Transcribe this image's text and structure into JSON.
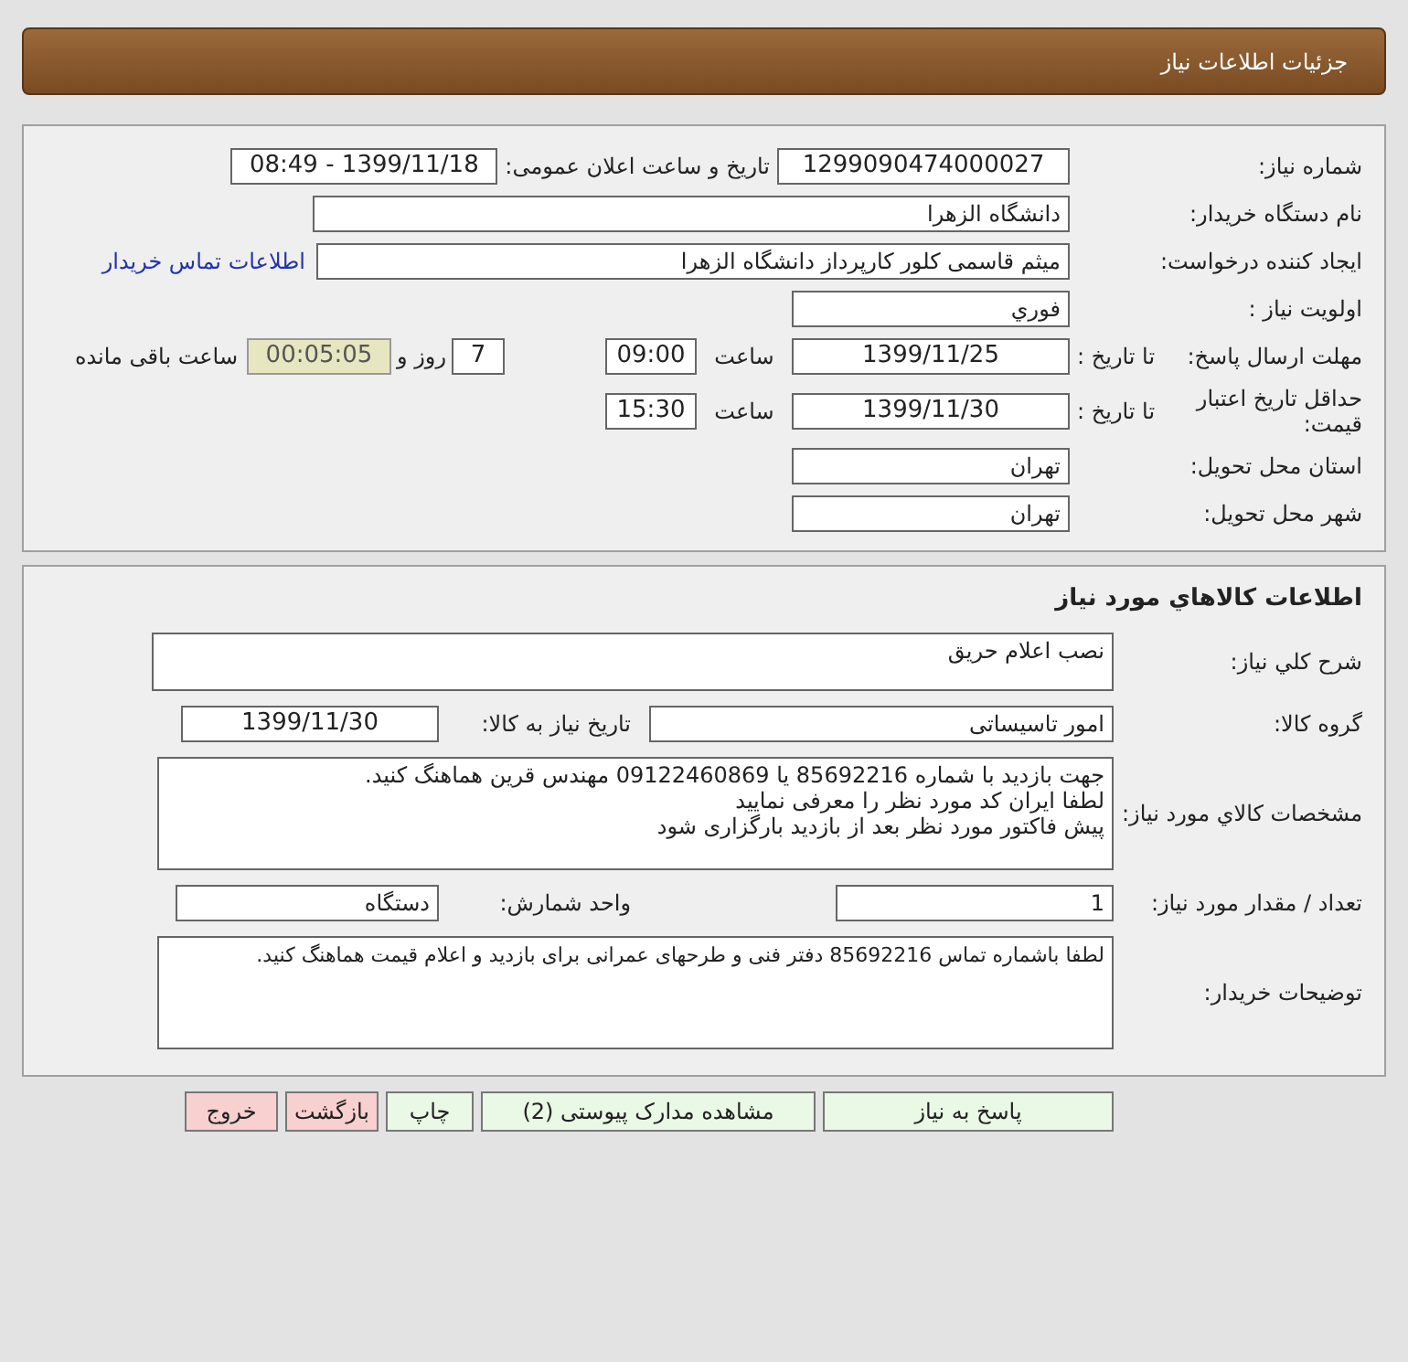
{
  "header": {
    "title": "جزئیات اطلاعات نیاز"
  },
  "need_details": {
    "need_number": {
      "label": "شماره نیاز:",
      "value": "1299090474000027"
    },
    "announce": {
      "label": "تاریخ و ساعت اعلان عمومی:",
      "value": "1399/11/18 - 08:49"
    },
    "buyer": {
      "label": "نام دستگاه خریدار:",
      "value": "دانشگاه الزهرا"
    },
    "creator": {
      "label": "ایجاد کننده درخواست:",
      "value": "میثم  قاسمی کلور کارپرداز دانشگاه الزهرا",
      "link": "اطلاعات تماس خریدار"
    },
    "priority": {
      "label": "اولویت نیاز :",
      "value": "فوري"
    },
    "deadline": {
      "label": "مهلت ارسال پاسخ:",
      "sublabel": "تا تاریخ :",
      "date": "1399/11/25",
      "time_label": "ساعت",
      "time": "09:00",
      "days": "7",
      "days_label": "روز و",
      "remaining": "00:05:05",
      "remaining_label": "ساعت باقی مانده"
    },
    "validity": {
      "label": "حداقل تاریخ اعتبار قیمت:",
      "sublabel": "تا تاریخ :",
      "date": "1399/11/30",
      "time_label": "ساعت",
      "time": "15:30"
    },
    "province": {
      "label": "استان محل تحویل:",
      "value": "تهران"
    },
    "city": {
      "label": "شهر محل تحویل:",
      "value": "تهران"
    }
  },
  "goods": {
    "title": "اطلاعات کالاهاي مورد نیاز",
    "description": {
      "label": "شرح کلي نیاز:",
      "value": "نصب اعلام حریق"
    },
    "group": {
      "label": "گروه کالا:",
      "value": "امور تاسیساتی",
      "date_label": "تاریخ نیاز به کالا:",
      "date": "1399/11/30"
    },
    "specs": {
      "label": "مشخصات کالاي مورد نیاز:",
      "lines": [
        "جهت بازدید با شماره 85692216 یا 09122460869 مهندس قرین هماهنگ کنید.",
        "لطفا ایران کد مورد نظر را معرفی نمایید",
        "پیش فاکتور مورد نظر بعد از بازدید بارگزاری شود"
      ]
    },
    "quantity": {
      "label": "تعداد / مقدار مورد نیاز:",
      "value": "1",
      "unit_label": "واحد شمارش:",
      "unit": "دستگاه"
    },
    "notes": {
      "label": "توضیحات خریدار:",
      "value": "لطفا باشماره تماس 85692216 دفتر فنی و طرحهای عمرانی برای بازدید و اعلام قیمت هماهنگ کنید."
    }
  },
  "buttons": [
    {
      "label": "پاسخ به نیاز",
      "kind": "primary"
    },
    {
      "label": "مشاهده مدارک پیوستی (2)",
      "kind": "primary"
    },
    {
      "label": "چاپ",
      "kind": "primary"
    },
    {
      "label": "بازگشت",
      "kind": "danger"
    },
    {
      "label": "خروج",
      "kind": "danger"
    }
  ]
}
